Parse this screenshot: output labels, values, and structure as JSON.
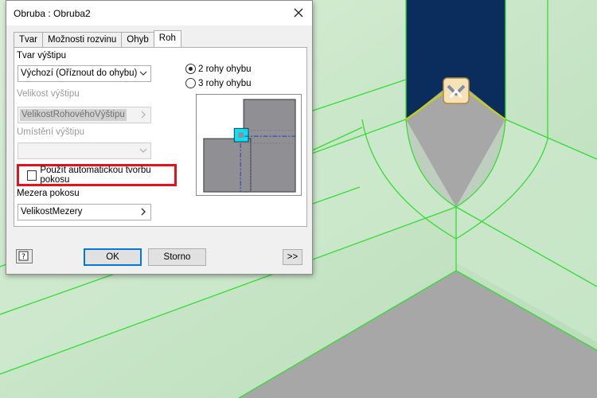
{
  "dialog": {
    "title": "Obruba : Obruba2",
    "tabs": [
      {
        "label": "Tvar"
      },
      {
        "label": "Možnosti rozvinu"
      },
      {
        "label": "Ohyb"
      },
      {
        "label": "Roh"
      }
    ],
    "active_tab": "Roh",
    "relief_shape": {
      "label": "Tvar výštipu",
      "value": "Výchozí (Oříznout do ohybu)"
    },
    "relief_size": {
      "label": "Velikost výštipu",
      "value": "VelikostRohovéhoVýštipu"
    },
    "relief_placement": {
      "label": "Umístění výštipu",
      "value": ""
    },
    "auto_miter": {
      "label": "Použít automatickou tvorbu pokosu",
      "checked": false
    },
    "miter_gap": {
      "label": "Mezera pokosu",
      "value": "VelikostMezery"
    },
    "corner_options": [
      {
        "label": "2 rohy ohybu",
        "selected": true
      },
      {
        "label": "3 rohy ohybu",
        "selected": false
      }
    ],
    "buttons": {
      "ok": "OK",
      "cancel": "Storno",
      "more": ">>"
    }
  },
  "colors": {
    "viewport_bg": "#c9e6c9",
    "navy_face": "#0a2d5e",
    "gray_face": "#a7a7a7",
    "edge_green": "#33dd33",
    "highlight_red": "#e0141e",
    "preview_cyan": "#00e5ff"
  }
}
